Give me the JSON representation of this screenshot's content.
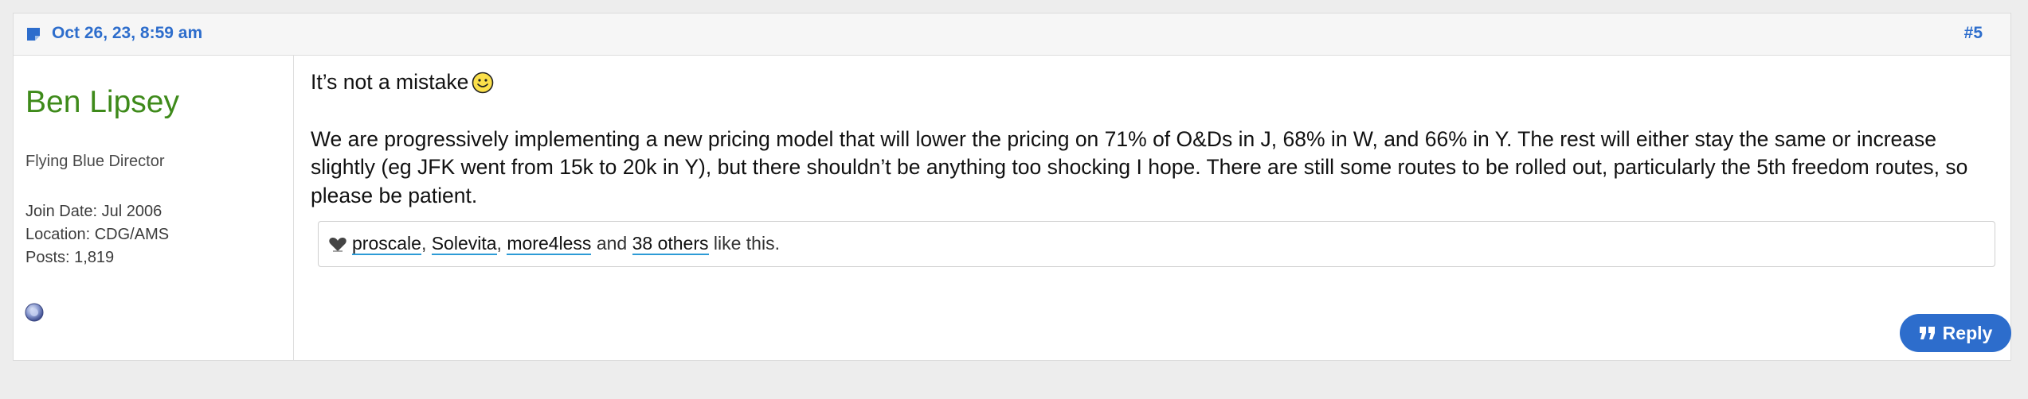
{
  "post": {
    "date": "Oct 26, 23, 8:59 am",
    "number": "#5"
  },
  "user": {
    "name": "Ben Lipsey",
    "title": "Flying Blue Director",
    "join_date": "Join Date: Jul 2006",
    "location": "Location: CDG/AMS",
    "posts": "Posts: 1,819",
    "status_icon": "online-status-icon"
  },
  "message": {
    "line1": "It’s not a mistake",
    "smiley": "smiley-icon",
    "paragraph2": "We are progressively implementing a new pricing model that will lower the pricing on 71% of O&Ds in J, 68% in W, and 66% in Y. The rest will either stay the same or increase slightly (eg JFK went from 15k to 20k in Y), but there shouldn’t be anything too shocking I hope. There are still some routes to be rolled out, particularly the 5th freedom routes, so please be patient."
  },
  "likes": {
    "users": [
      "proscale",
      "Solevita",
      "more4less"
    ],
    "separator": ", ",
    "and": " and ",
    "others": "38 others",
    "suffix": " like this."
  },
  "actions": {
    "reply_label": "Reply"
  },
  "colors": {
    "accent": "#2d6dcc",
    "username": "#3e8a1a"
  }
}
